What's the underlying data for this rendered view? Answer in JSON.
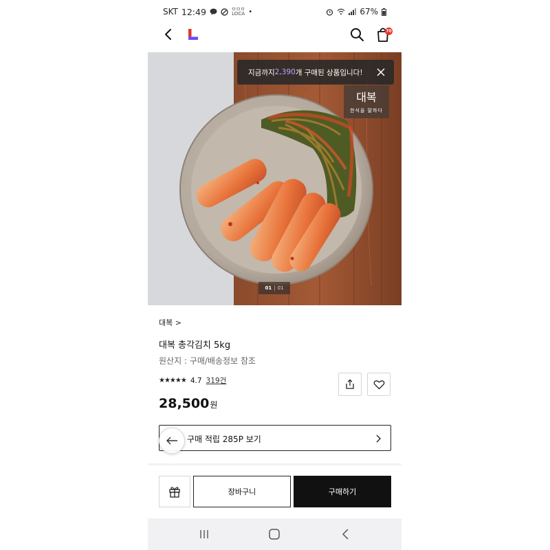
{
  "status_bar": {
    "carrier": "SKT",
    "time": "12:49",
    "app_small_text_1": "ㅁㅁㅁ",
    "app_small_text_2": "LOCA",
    "battery": "67%"
  },
  "header": {
    "cart_badge": "70"
  },
  "image": {
    "purchase_banner_prefix": "지금까지 ",
    "purchase_count": "2,390",
    "purchase_banner_suffix": "개 구매된 상품입니다!",
    "brand_box_title": "대복",
    "brand_box_subtitle": "한식을 말하다",
    "pager_current": "01",
    "pager_sep": "|",
    "pager_total": "01"
  },
  "product": {
    "brand_link": "대복 >",
    "title": "대복 총각김치 5kg",
    "origin": "원산지 : 구매/배송정보 참조",
    "stars": "★★★★★",
    "rating": "4.7",
    "review_count": "319건",
    "price": "28,500",
    "currency": "원"
  },
  "points": {
    "tag": "적립",
    "text": "구매 적립 285P 보기"
  },
  "actions": {
    "cart_label": "장바구니",
    "buy_label": "구매하기"
  },
  "colors": {
    "accent_red": "#e4352b",
    "accent_purple": "#6c4bff",
    "buy_button": "#111111"
  }
}
